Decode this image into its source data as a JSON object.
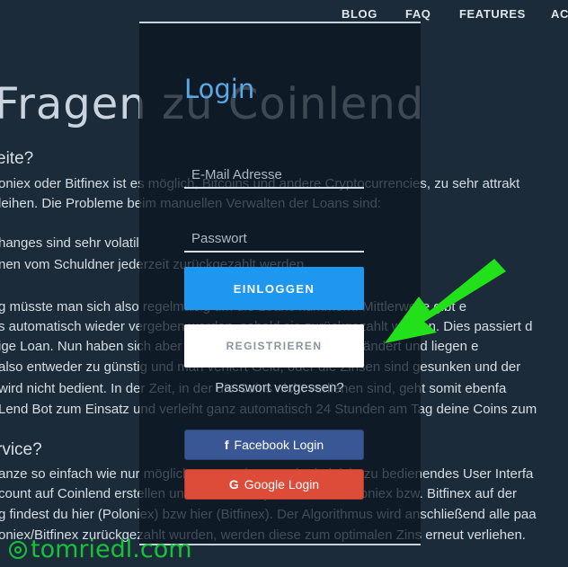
{
  "nav": {
    "items": [
      "BLOG",
      "FAQ",
      "FEATURES",
      "AC"
    ]
  },
  "background": {
    "heading": "Fragen zu Coinlend",
    "section1_title": "eite?",
    "lines": [
      "oniex oder Bitfinex ist es möglich, Bitcoins und andere Cryptocurrencies, zu sehr attrakt",
      "leihen. Die Probleme beim manuellen Verwalten der Loans sind:",
      "hanges sind sehr volatil",
      "nen vom Schuldner jederzeit zurückgezahlt werden",
      "g müsste man sich also regelmäßig um die Loans kümmern. Mittlerweile gibt e",
      "s automatisch wieder vergeben werden, sobald sie zurückgezahlt wurden. Dies passiert d",
      "ige Loan. Nun haben sich aber die Zinsen am Markt stark verändert und liegen e",
      "also entweder zu günstig und man verliert Geld, oder die Zinsen sind gesunken und der",
      "wird nicht bedient. In der Zeit, in der die Coins nicht verliehen sind, geht somit ebenfa",
      "Lend Bot zum Einsatz und verleiht ganz automatisch 24 Stunden am Tag deine Coins zum"
    ],
    "section2_title": "rvice?",
    "lines2": [
      "anze so einfach wie nur möglich zu gestalten, auch ein leicht zu bedienendes User Interfa",
      "count auf Coinlend erstellen und den API-Key von deiner Poloniex bzw. Bitfinex auf der",
      "g findest du hier (Poloniex) bzw hier (Bitfinex). Der Algorithmus wird anschließend alle paa",
      "oniex/Bitfinex zurückgezahlt wurden, werden diese zum optimalen Zins erneut verliehen."
    ]
  },
  "login": {
    "title": "Login",
    "email_placeholder": "E-Mail Adresse",
    "password_placeholder": "Passwort",
    "login_button": "EINLOGGEN",
    "register_button": "REGISTRIEREN",
    "forgot_password": "Passwort vergessen?",
    "facebook_button": "Facebook Login",
    "google_button": "Google Login",
    "facebook_icon": "f",
    "google_icon": "G"
  },
  "watermark": {
    "text": "tomriedl.com"
  },
  "colors": {
    "accent": "#1e97f0",
    "facebook": "#3a5795",
    "google": "#dd4b39",
    "arrow": "#22e01a"
  }
}
